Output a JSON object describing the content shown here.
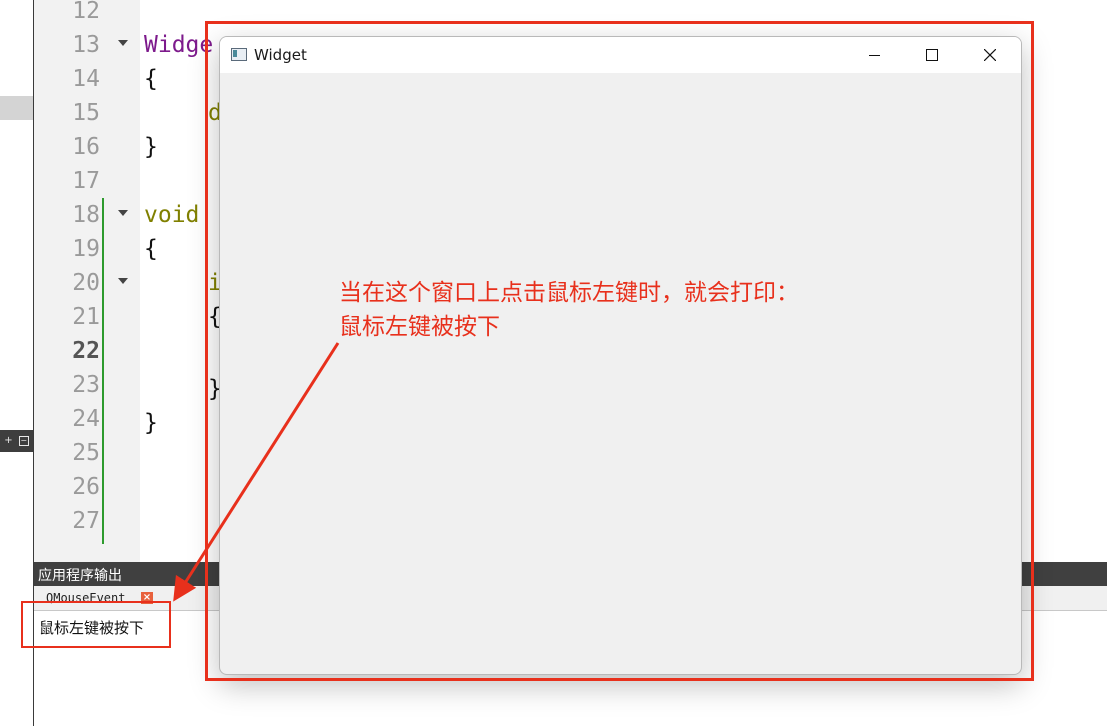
{
  "editor": {
    "line_numbers": [
      "12",
      "13",
      "14",
      "15",
      "16",
      "17",
      "18",
      "19",
      "20",
      "21",
      "22",
      "23",
      "24",
      "25",
      "26",
      "27"
    ],
    "current_line": "22",
    "code_fragments": {
      "l13": "Widge",
      "l14": "{",
      "l15": "d",
      "l16": "}",
      "l18": "void",
      "l19": "{",
      "l20": "i",
      "l21": "{",
      "l23": "}",
      "l24": "}"
    }
  },
  "output_pane": {
    "title": "应用程序输出",
    "tab_label": "QMouseEvent",
    "tab_close_icon": "×",
    "line": "鼠标左键被按下"
  },
  "window": {
    "title": "Widget"
  },
  "annotation": {
    "line1": "当在这个窗口上点击鼠标左键时，就会打印：",
    "line2": "鼠标左键被按下"
  },
  "colors": {
    "highlight_red": "#e8301c",
    "keyword_purple": "#7d1a8c",
    "keyword_olive": "#808000",
    "output_header": "#404040"
  }
}
